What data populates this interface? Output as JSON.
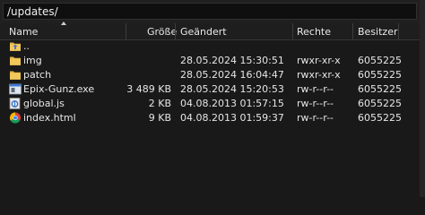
{
  "path": "/updates/",
  "columns": {
    "name": "Name",
    "size": "Größe",
    "modified": "Geändert",
    "permissions": "Rechte",
    "owner": "Besitzer"
  },
  "rows": [
    {
      "name": "..",
      "size": "",
      "modified": "",
      "permissions": "",
      "owner": "",
      "icon": "folder-up-icon"
    },
    {
      "name": "img",
      "size": "",
      "modified": "28.05.2024 15:30:51",
      "permissions": "rwxr-xr-x",
      "owner": "6055225",
      "icon": "folder-icon"
    },
    {
      "name": "patch",
      "size": "",
      "modified": "28.05.2024 16:04:47",
      "permissions": "rwxr-xr-x",
      "owner": "6055225",
      "icon": "folder-icon"
    },
    {
      "name": "Epix-Gunz.exe",
      "size": "3 489 KB",
      "modified": "28.05.2024 15:20:53",
      "permissions": "rw-r--r--",
      "owner": "6055225",
      "icon": "exe-file-icon"
    },
    {
      "name": "global.js",
      "size": "2 KB",
      "modified": "04.08.2013 01:57:15",
      "permissions": "rw-r--r--",
      "owner": "6055225",
      "icon": "js-file-icon"
    },
    {
      "name": "index.html",
      "size": "9 KB",
      "modified": "04.08.2013 01:59:37",
      "permissions": "rw-r--r--",
      "owner": "6055225",
      "icon": "chrome-html-icon"
    }
  ]
}
